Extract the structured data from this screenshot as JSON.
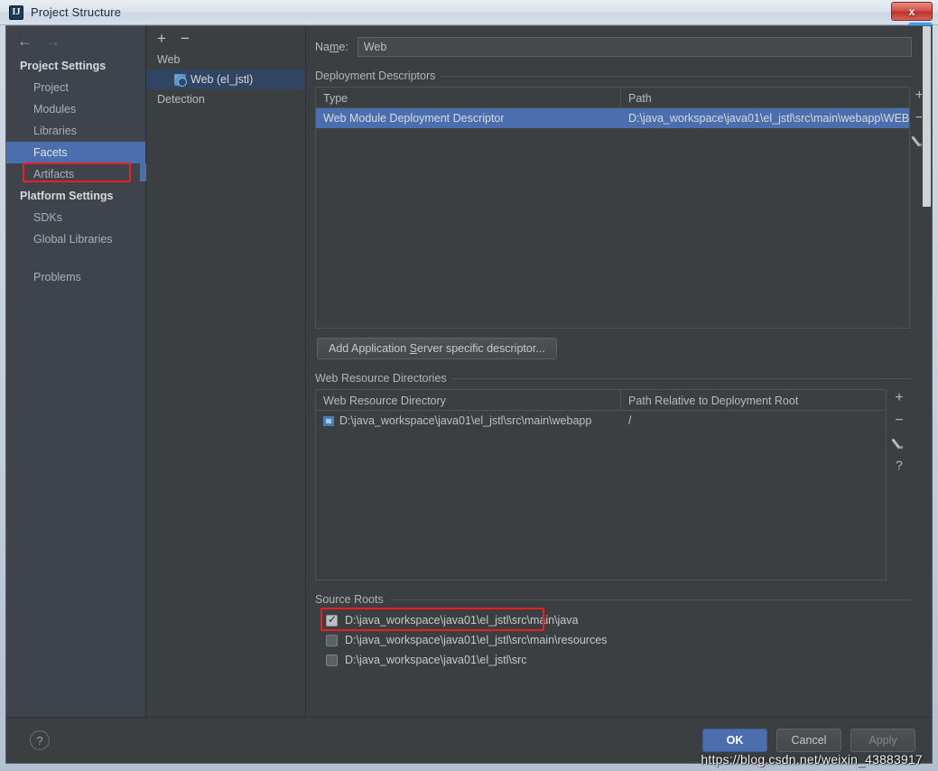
{
  "window": {
    "title": "Project Structure",
    "app_icon": "IJ",
    "close_label": "x"
  },
  "badge": {
    "icon": "baidu-cloud-icon",
    "glyph": "∞"
  },
  "sidebar": {
    "back_arrow": "←",
    "forward_arrow": "→",
    "groups": [
      {
        "title": "Project Settings",
        "items": [
          {
            "label": "Project",
            "selected": false
          },
          {
            "label": "Modules",
            "selected": false
          },
          {
            "label": "Libraries",
            "selected": false
          },
          {
            "label": "Facets",
            "selected": true
          },
          {
            "label": "Artifacts",
            "selected": false
          }
        ]
      },
      {
        "title": "Platform Settings",
        "items": [
          {
            "label": "SDKs",
            "selected": false
          },
          {
            "label": "Global Libraries",
            "selected": false
          }
        ]
      }
    ],
    "problems_label": "Problems"
  },
  "facets_tree": {
    "add_label": "+",
    "remove_label": "−",
    "root": "Web",
    "child": "Web (el_jstl)",
    "detection": "Detection"
  },
  "main": {
    "name_label_pre": "Na",
    "name_label_accel": "m",
    "name_label_post": "e:",
    "name_value": "Web",
    "deployment": {
      "section_title": "Deployment Descriptors",
      "headers": [
        "Type",
        "Path"
      ],
      "rows": [
        {
          "type": "Web Module Deployment Descriptor",
          "path": "D:\\java_workspace\\java01\\el_jstl\\src\\main\\webapp\\WEB"
        }
      ],
      "buttons": [
        "+",
        "−",
        "edit-pencil"
      ],
      "add_descriptor_pre": "Add Application ",
      "add_descriptor_accel": "S",
      "add_descriptor_post": "erver specific descriptor..."
    },
    "web_resources": {
      "section_title": "Web Resource Directories",
      "headers": [
        "Web Resource Directory",
        "Path Relative to Deployment Root"
      ],
      "rows": [
        {
          "directory": "D:\\java_workspace\\java01\\el_jstl\\src\\main\\webapp",
          "relative": "/"
        }
      ],
      "buttons": [
        "+",
        "−",
        "edit-pencil",
        "?"
      ]
    },
    "source_roots": {
      "section_title": "Source Roots",
      "items": [
        {
          "path": "D:\\java_workspace\\java01\\el_jstl\\src\\main\\java",
          "checked": true
        },
        {
          "path": "D:\\java_workspace\\java01\\el_jstl\\src\\main\\resources",
          "checked": false
        },
        {
          "path": "D:\\java_workspace\\java01\\el_jstl\\src",
          "checked": false
        }
      ]
    }
  },
  "footer": {
    "help": "?",
    "ok": "OK",
    "cancel": "Cancel",
    "apply": "Apply"
  },
  "watermark": "https://blog.csdn.net/weixin_43883917",
  "colors": {
    "accent_blue": "#4b6eaf",
    "annotation_red": "#ee1c23",
    "panel_bg": "#3c3f41",
    "sidebar_bg": "#3f444c"
  }
}
